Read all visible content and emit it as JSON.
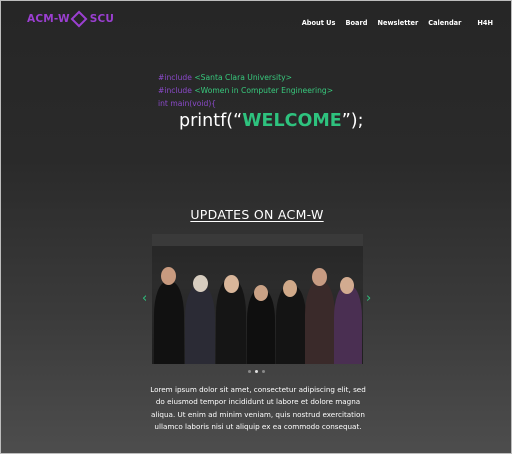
{
  "nav": {
    "logo_left": "ACM-W",
    "logo_right": "SCU",
    "items": [
      "About Us",
      "Board",
      "Newsletter",
      "Calendar",
      "H4H"
    ]
  },
  "hero": {
    "line1_kw": "#include",
    "line1_val": "<Santa Clara University>",
    "line2_kw": "#include",
    "line2_val": "<Women in Computer Engineering>",
    "line3": "int main(void){",
    "printf_pre": "printf(“",
    "printf_word": "WELCOME",
    "printf_post": "”);"
  },
  "updates": {
    "heading": "UPDATES ON ACM-W",
    "carousel": {
      "slides": 3,
      "active": 2,
      "prev_icon": "chevron-left-icon",
      "next_icon": "chevron-right-icon"
    },
    "text": "Lorem ipsum dolor sit amet, consectetur adipiscing elit, sed do eiusmod tempor incididunt ut labore et dolore magna aliqua. Ut enim ad minim veniam, quis nostrud exercitation ullamco laboris nisi ut aliquip ex ea commodo consequat."
  },
  "colors": {
    "accent_purple": "#9b3fd1",
    "accent_green": "#2ec27e"
  }
}
